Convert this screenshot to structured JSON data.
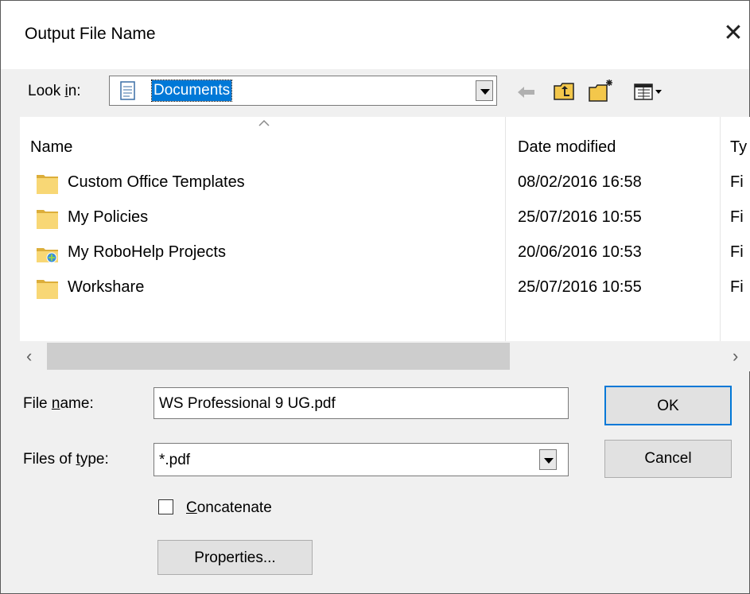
{
  "dialog": {
    "title": "Output File Name",
    "close_glyph": "✕"
  },
  "lookin": {
    "label_pre": "Look ",
    "label_accel": "i",
    "label_post": "n:",
    "value": "Documents",
    "toolbar": [
      "back-arrow-icon",
      "up-one-level-icon",
      "new-folder-icon",
      "view-menu-icon"
    ]
  },
  "list": {
    "columns": [
      "Name",
      "Date modified",
      "Ty"
    ],
    "rows": [
      {
        "name": "Custom Office Templates",
        "date": "08/02/2016 16:58",
        "type": "Fi",
        "icon": "folder-icon"
      },
      {
        "name": "My Policies",
        "date": "25/07/2016 10:55",
        "type": "Fi",
        "icon": "folder-icon"
      },
      {
        "name": "My RoboHelp Projects",
        "date": "20/06/2016 10:53",
        "type": "Fi",
        "icon": "special-folder-icon"
      },
      {
        "name": "Workshare",
        "date": "25/07/2016 10:55",
        "type": "Fi",
        "icon": "folder-icon"
      }
    ],
    "scroll_left": "‹",
    "scroll_right": "›"
  },
  "filename": {
    "label_pre": "File ",
    "label_accel": "n",
    "label_post": "ame:",
    "value": "WS Professional 9 UG.pdf"
  },
  "filetype": {
    "label_pre": "Files of ",
    "label_accel": "t",
    "label_post": "ype:",
    "value": "*.pdf"
  },
  "concatenate": {
    "label_accel": "C",
    "label_post": "oncatenate",
    "checked": false
  },
  "buttons": {
    "ok": "OK",
    "cancel": "Cancel",
    "properties": "Properties..."
  },
  "colors": {
    "selection": "#0078d7",
    "folder": "#f3c74b",
    "dialog_bg": "#f0f0f0"
  }
}
